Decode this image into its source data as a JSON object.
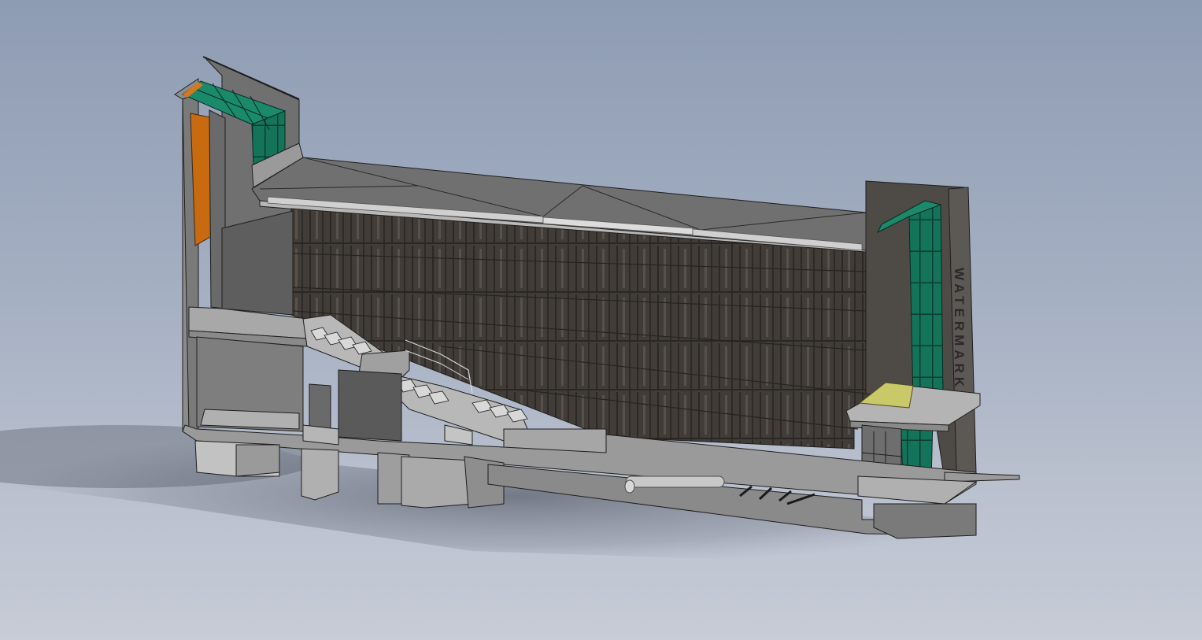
{
  "viewport": {
    "background_top": "#8e9cb3",
    "background_bottom": "#c7ccd6"
  },
  "model": {
    "sign_text": "WATERMARK",
    "colors": {
      "roof_panels": "#11745a",
      "orange_panel": "#c76a10",
      "canopy_yellow": "#c9c96a",
      "facade_dark": "#3f3b37",
      "concrete": "#8a8a8a",
      "concrete_light": "#b5b5b5",
      "edge_lines": "#1e1e1e"
    }
  }
}
